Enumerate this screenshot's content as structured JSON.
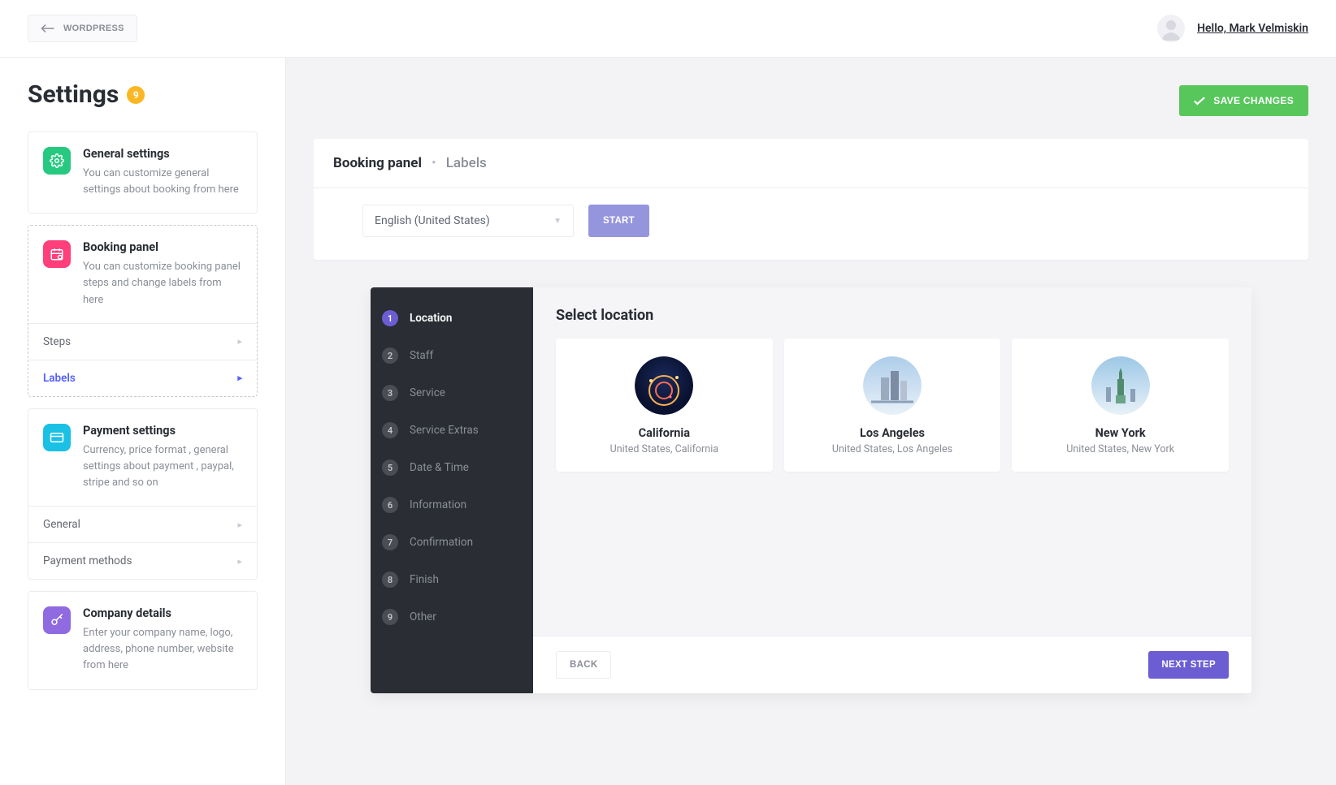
{
  "header": {
    "wordpress_label": "WORDPRESS",
    "greeting": "Hello, Mark Velmiskin"
  },
  "sidebar": {
    "title": "Settings",
    "badge": "9",
    "items": [
      {
        "title": "General settings",
        "desc": "You can customize general settings about booking from here"
      },
      {
        "title": "Booking panel",
        "desc": "You can customize booking panel steps and change labels from here",
        "subitems": [
          {
            "label": "Steps",
            "active": false
          },
          {
            "label": "Labels",
            "active": true
          }
        ]
      },
      {
        "title": "Payment settings",
        "desc": "Currency, price format , general settings about payment , paypal, stripe and so on",
        "subitems": [
          {
            "label": "General",
            "active": false
          },
          {
            "label": "Payment methods",
            "active": false
          }
        ]
      },
      {
        "title": "Company details",
        "desc": "Enter your company name, logo, address, phone number, website from here"
      }
    ]
  },
  "main": {
    "save_label": "SAVE CHANGES",
    "breadcrumb": {
      "a": "Booking panel",
      "b": "Labels"
    },
    "language_selected": "English (United States)",
    "start_label": "START"
  },
  "booking": {
    "steps": [
      {
        "n": "1",
        "label": "Location",
        "active": true
      },
      {
        "n": "2",
        "label": "Staff"
      },
      {
        "n": "3",
        "label": "Service"
      },
      {
        "n": "4",
        "label": "Service Extras"
      },
      {
        "n": "5",
        "label": "Date & Time"
      },
      {
        "n": "6",
        "label": "Information"
      },
      {
        "n": "7",
        "label": "Confirmation"
      },
      {
        "n": "8",
        "label": "Finish"
      },
      {
        "n": "9",
        "label": "Other"
      }
    ],
    "title": "Select location",
    "locations": [
      {
        "name": "California",
        "sub": "United States, California"
      },
      {
        "name": "Los Angeles",
        "sub": "United States, Los Angeles"
      },
      {
        "name": "New York",
        "sub": "United States, New York"
      }
    ],
    "back_label": "BACK",
    "next_label": "NEXT STEP"
  }
}
